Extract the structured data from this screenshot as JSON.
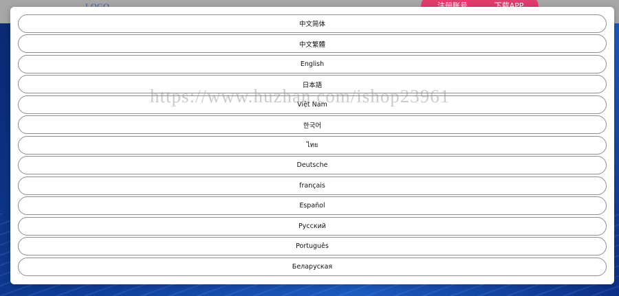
{
  "background_page": {
    "logo_text": "LOGO",
    "register_button": "注册账号",
    "download_button": "下载APP"
  },
  "language_modal": {
    "options": [
      {
        "label": "中文简体"
      },
      {
        "label": "中文繁體"
      },
      {
        "label": "English"
      },
      {
        "label": "日本語"
      },
      {
        "label": "Việt Nam"
      },
      {
        "label": "한국어"
      },
      {
        "label": "ไทย"
      },
      {
        "label": "Deutsche"
      },
      {
        "label": "français"
      },
      {
        "label": "Español"
      },
      {
        "label": "Русский"
      },
      {
        "label": "Português"
      },
      {
        "label": "Беларуская"
      }
    ]
  },
  "watermark": {
    "text": "https://www.huzhan.com/ishop23961"
  },
  "colors": {
    "overlay_gray": "#9a9a9a",
    "brand_pink": "#e03c6d",
    "page_blue": "#0f3d98",
    "item_border": "#8c8c8c"
  }
}
